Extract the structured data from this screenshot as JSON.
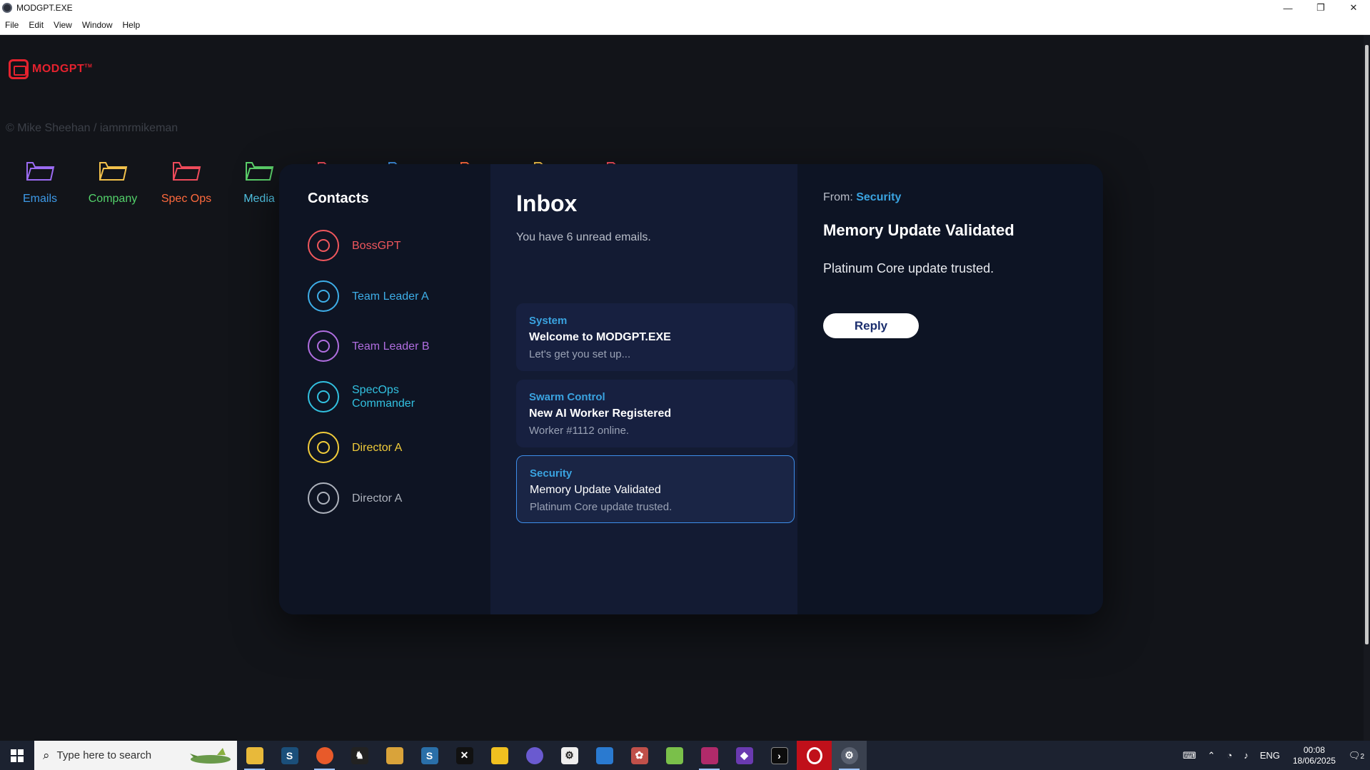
{
  "window": {
    "title": "MODGPT.EXE",
    "controls": {
      "minimize": "—",
      "restore": "❐",
      "close": "✕"
    }
  },
  "menu": [
    "File",
    "Edit",
    "View",
    "Window",
    "Help"
  ],
  "logo": {
    "text": "MODGPT",
    "tm": "TM"
  },
  "credit": "© Mike Sheehan / iammrmikeman",
  "folders": [
    {
      "label": "Emails",
      "icon_color": "#9b6bf2",
      "label_color": "#3d9ae8"
    },
    {
      "label": "Company",
      "icon_color": "#f2c14b",
      "label_color": "#53d26a"
    },
    {
      "label": "Spec Ops",
      "icon_color": "#ef4b5b",
      "label_color": "#ff6a3d"
    },
    {
      "label": "Media",
      "icon_color": "#5bd06a",
      "label_color": "#52c7e8"
    }
  ],
  "contacts": {
    "title": "Contacts",
    "items": [
      {
        "name": "BossGPT",
        "color": "#f0575d"
      },
      {
        "name": "Team Leader A",
        "color": "#3eaee8"
      },
      {
        "name": "Team Leader B",
        "color": "#b06ee0"
      },
      {
        "name": "SpecOps Commander",
        "color": "#32c1e0"
      },
      {
        "name": "Director A",
        "color": "#f1cc3a"
      },
      {
        "name": "Director A",
        "color": "#aeb3bd"
      }
    ]
  },
  "inbox": {
    "title": "Inbox",
    "unread_text": "You have 6 unread emails.",
    "emails": [
      {
        "from": "System",
        "subject": "Welcome to MODGPT.EXE",
        "preview": "Let's get you set up..."
      },
      {
        "from": "Swarm Control",
        "subject": "New AI Worker Registered",
        "preview": "Worker #1112 online."
      },
      {
        "from": "Security",
        "subject": "Memory Update Validated",
        "preview": "Platinum Core update trusted."
      }
    ]
  },
  "detail": {
    "from_label": "From:",
    "from": "Security",
    "subject": "Memory Update Validated",
    "body": "Platinum Core update trusted.",
    "reply_label": "Reply"
  },
  "taskbar": {
    "search_placeholder": "Type here to search",
    "apps": [
      "file-explorer",
      "steam",
      "firefox",
      "app-4",
      "app-5",
      "steam",
      "app-7",
      "duck-app",
      "browser",
      "settings",
      "app-11",
      "app-12",
      "app-13",
      "winrar",
      "visual-studio",
      "terminal",
      "opera",
      "modgpt"
    ],
    "language": "ENG",
    "time": "00:08",
    "date": "18/06/2025",
    "notifications": "2"
  }
}
